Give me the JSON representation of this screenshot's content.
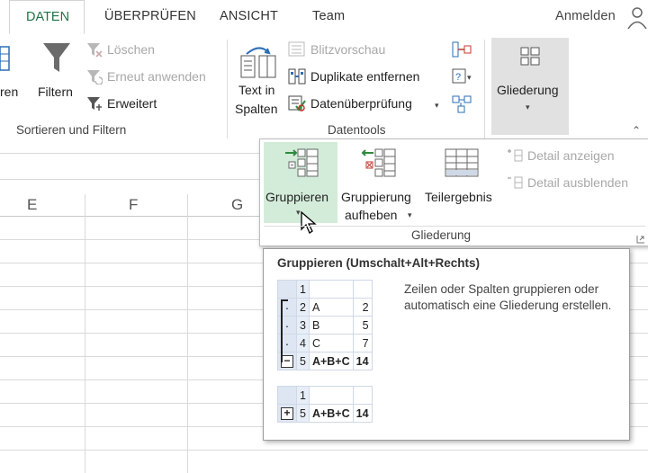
{
  "tabs": [
    {
      "label": "DATEN"
    },
    {
      "label": "ÜBERPRÜFEN"
    },
    {
      "label": "ANSICHT"
    },
    {
      "label": "Team"
    }
  ],
  "account": {
    "signin": "Anmelden"
  },
  "ribbon": {
    "sort_filter": {
      "partial_label": "ren",
      "filter": "Filtern",
      "clear": "Löschen",
      "reapply": "Erneut anwenden",
      "advanced": "Erweitert",
      "group_label": "Sortieren und Filtern"
    },
    "datatools": {
      "text_to_columns_1": "Text in",
      "text_to_columns_2": "Spalten",
      "flash_fill": "Blitzvorschau",
      "remove_duplicates": "Duplikate entfernen",
      "data_validation": "Datenüberprüfung",
      "group_label": "Datentools"
    },
    "outline": {
      "label": "Gliederung"
    }
  },
  "sheet": {
    "columns": [
      "E",
      "F",
      "G"
    ]
  },
  "dropdown": {
    "group": "Gruppieren",
    "ungroup_1": "Gruppierung",
    "ungroup_2": "aufheben",
    "subtotal": "Teilergebnis",
    "show_detail": "Detail anzeigen",
    "hide_detail": "Detail ausblenden",
    "group_label": "Gliederung"
  },
  "tooltip": {
    "title": "Gruppieren (Umschalt+Alt+Rechts)",
    "description": "Zeilen oder Spalten gruppieren oder automatisch eine Gliederung erstellen.",
    "example_top": {
      "rows": [
        {
          "row": "1",
          "label": "",
          "value": ""
        },
        {
          "row": "2",
          "label": "A",
          "value": "2"
        },
        {
          "row": "3",
          "label": "B",
          "value": "5"
        },
        {
          "row": "4",
          "label": "C",
          "value": "7"
        },
        {
          "row": "5",
          "label": "A+B+C",
          "value": "14"
        }
      ]
    },
    "example_bottom": {
      "rows": [
        {
          "row": "1",
          "label": "",
          "value": ""
        },
        {
          "row": "5",
          "label": "A+B+C",
          "value": "14"
        }
      ]
    },
    "collapse_symbol": "−",
    "expand_symbol": "+"
  },
  "colors": {
    "accent": "#217346",
    "hover_green": "#d3ecd9",
    "selected_gray": "#e1e1e1"
  }
}
